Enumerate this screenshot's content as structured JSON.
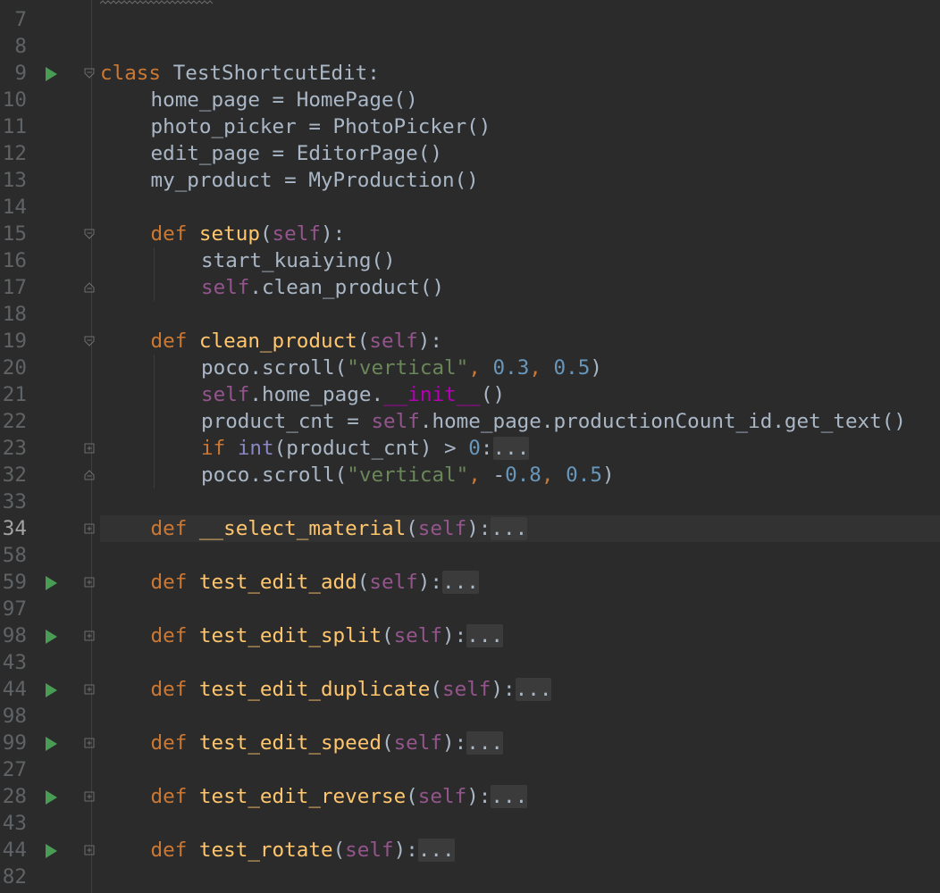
{
  "editor": {
    "lines": [
      {
        "num": "7"
      },
      {
        "num": "8"
      },
      {
        "num": "9",
        "run": true,
        "fold": "open",
        "indent": 0,
        "tokens": [
          [
            "kw",
            "class "
          ],
          [
            "",
            "TestShortcutEdit:"
          ]
        ]
      },
      {
        "num": "10",
        "indent": 1,
        "tokens": [
          [
            "",
            "home_page = HomePage()"
          ]
        ]
      },
      {
        "num": "11",
        "indent": 1,
        "tokens": [
          [
            "",
            "photo_picker = PhotoPicker()"
          ]
        ]
      },
      {
        "num": "12",
        "indent": 1,
        "tokens": [
          [
            "",
            "edit_page = EditorPage()"
          ]
        ]
      },
      {
        "num": "13",
        "indent": 1,
        "tokens": [
          [
            "",
            "my_product = MyProduction()"
          ]
        ]
      },
      {
        "num": "14"
      },
      {
        "num": "15",
        "fold": "open",
        "indent": 1,
        "tokens": [
          [
            "kw",
            "def "
          ],
          [
            "fn",
            "setup"
          ],
          [
            "",
            "("
          ],
          [
            "self",
            "self"
          ],
          [
            "",
            "):"
          ]
        ]
      },
      {
        "num": "16",
        "indent": 2,
        "tokens": [
          [
            "",
            "start_kuaiying()"
          ]
        ]
      },
      {
        "num": "17",
        "fold": "end",
        "indent": 2,
        "tokens": [
          [
            "self",
            "self"
          ],
          [
            "",
            ".clean_product()"
          ]
        ]
      },
      {
        "num": "18"
      },
      {
        "num": "19",
        "fold": "open",
        "indent": 1,
        "tokens": [
          [
            "kw",
            "def "
          ],
          [
            "fn",
            "clean_product"
          ],
          [
            "",
            "("
          ],
          [
            "self",
            "self"
          ],
          [
            "",
            "):"
          ]
        ]
      },
      {
        "num": "20",
        "indent": 2,
        "tokens": [
          [
            "",
            "poco.scroll("
          ],
          [
            "str",
            "\"vertical\""
          ],
          [
            "kw",
            ", "
          ],
          [
            "num",
            "0.3"
          ],
          [
            "kw",
            ", "
          ],
          [
            "num",
            "0.5"
          ],
          [
            "",
            ")"
          ]
        ]
      },
      {
        "num": "21",
        "indent": 2,
        "tokens": [
          [
            "self",
            "self"
          ],
          [
            "",
            ".home_page."
          ],
          [
            "magic",
            "__init__"
          ],
          [
            "",
            "()"
          ]
        ]
      },
      {
        "num": "22",
        "indent": 2,
        "tokens": [
          [
            "",
            "product_cnt = "
          ],
          [
            "self",
            "self"
          ],
          [
            "",
            ".home_page.productionCount_id.get_text()"
          ]
        ]
      },
      {
        "num": "23",
        "fold": "closed",
        "indent": 2,
        "tokens": [
          [
            "kw",
            "if "
          ],
          [
            "builtin",
            "int"
          ],
          [
            "",
            "(product_cnt) > "
          ],
          [
            "num",
            "0"
          ],
          [
            "",
            ":"
          ],
          [
            "ellipsis",
            "..."
          ]
        ]
      },
      {
        "num": "32",
        "fold": "end",
        "indent": 2,
        "tokens": [
          [
            "",
            "poco.scroll("
          ],
          [
            "str",
            "\"vertical\""
          ],
          [
            "kw",
            ", "
          ],
          [
            "",
            "-"
          ],
          [
            "num",
            "0.8"
          ],
          [
            "kw",
            ", "
          ],
          [
            "num",
            "0.5"
          ],
          [
            "",
            ")"
          ]
        ]
      },
      {
        "num": "33"
      },
      {
        "num": "34",
        "current": true,
        "fold": "closed",
        "indent": 1,
        "tokens": [
          [
            "kw",
            "def "
          ],
          [
            "fn",
            "__select_material"
          ],
          [
            "",
            "("
          ],
          [
            "self",
            "self"
          ],
          [
            "",
            "):"
          ],
          [
            "ellipsis",
            "..."
          ]
        ]
      },
      {
        "num": "58"
      },
      {
        "num": "59",
        "run": true,
        "fold": "closed",
        "indent": 1,
        "tokens": [
          [
            "kw",
            "def "
          ],
          [
            "fn",
            "test_edit_add"
          ],
          [
            "",
            "("
          ],
          [
            "self",
            "self"
          ],
          [
            "",
            "):"
          ],
          [
            "ellipsis",
            "..."
          ]
        ]
      },
      {
        "num": "97"
      },
      {
        "num": "98",
        "run": true,
        "fold": "closed",
        "indent": 1,
        "tokens": [
          [
            "kw",
            "def "
          ],
          [
            "fn",
            "test_edit_split"
          ],
          [
            "",
            "("
          ],
          [
            "self",
            "self"
          ],
          [
            "",
            "):"
          ],
          [
            "ellipsis",
            "..."
          ]
        ]
      },
      {
        "num": "43"
      },
      {
        "num": "44",
        "run": true,
        "fold": "closed",
        "indent": 1,
        "tokens": [
          [
            "kw",
            "def "
          ],
          [
            "fn",
            "test_edit_duplicate"
          ],
          [
            "",
            "("
          ],
          [
            "self",
            "self"
          ],
          [
            "",
            "):"
          ],
          [
            "ellipsis",
            "..."
          ]
        ]
      },
      {
        "num": "98"
      },
      {
        "num": "99",
        "run": true,
        "fold": "closed",
        "indent": 1,
        "tokens": [
          [
            "kw",
            "def "
          ],
          [
            "fn",
            "test_edit_speed"
          ],
          [
            "",
            "("
          ],
          [
            "self",
            "self"
          ],
          [
            "",
            "):"
          ],
          [
            "ellipsis",
            "..."
          ]
        ]
      },
      {
        "num": "27"
      },
      {
        "num": "28",
        "run": true,
        "fold": "closed",
        "indent": 1,
        "tokens": [
          [
            "kw",
            "def "
          ],
          [
            "fn",
            "test_edit_reverse"
          ],
          [
            "",
            "("
          ],
          [
            "self",
            "self"
          ],
          [
            "",
            "):"
          ],
          [
            "ellipsis",
            "..."
          ]
        ]
      },
      {
        "num": "43"
      },
      {
        "num": "44",
        "run": true,
        "fold": "closed",
        "indent": 1,
        "tokens": [
          [
            "kw",
            "def "
          ],
          [
            "fn",
            "test_rotate"
          ],
          [
            "",
            "("
          ],
          [
            "self",
            "self"
          ],
          [
            "",
            "):"
          ],
          [
            "ellipsis",
            "..."
          ]
        ]
      },
      {
        "num": "82"
      }
    ]
  },
  "colors": {
    "background": "#2b2b2b",
    "keyword": "#cc7832",
    "function": "#ffc66d",
    "self": "#94558d",
    "string": "#6a8759",
    "number": "#6897bb",
    "builtin": "#8888c6",
    "magic": "#b200b2",
    "run_icon": "#499c54"
  },
  "icons": {
    "run": "run-triangle-icon",
    "fold_open": "fold-collapse-icon",
    "fold_closed": "fold-expand-icon",
    "fold_end": "fold-end-icon"
  }
}
